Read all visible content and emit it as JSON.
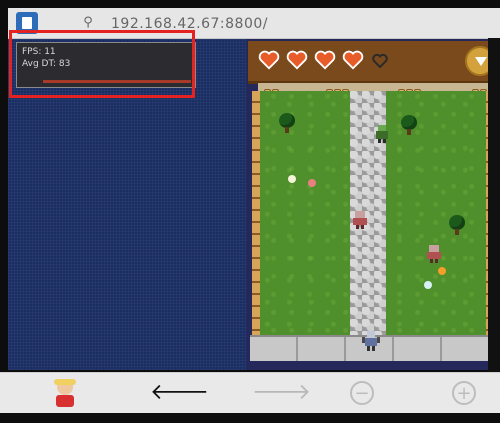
{
  "browser": {
    "url": "192.168.42.67:8800/"
  },
  "stats": {
    "fps": "FPS: 11",
    "avg_dt": "Avg DT: 83"
  },
  "game": {
    "hearts_full": 4,
    "hearts_total": 5
  },
  "toolbar": {
    "back_icon": "left-arrow-icon",
    "forward_icon": "right-arrow-icon",
    "zoom_out_icon": "zoom-out-icon",
    "zoom_in_icon": "zoom-in-icon"
  },
  "colors": {
    "left_bg": "#1a2e64",
    "highlight": "#e52222",
    "grass": "#4f8f2c",
    "hud_wood": "#7a4a1c",
    "heart": "#e85c2a"
  }
}
